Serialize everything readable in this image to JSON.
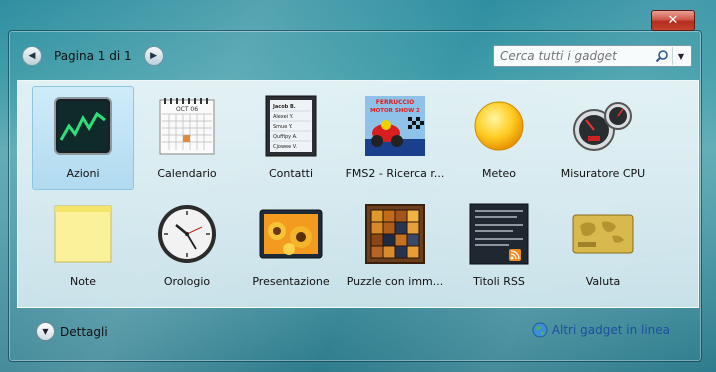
{
  "window": {
    "close_label": "✕"
  },
  "toolbar": {
    "pager_text": "Pagina 1 di 1",
    "prev_glyph": "◀",
    "next_glyph": "▶",
    "search_placeholder": "Cerca tutti i gadget",
    "search_icon": "search-icon",
    "dropdown_glyph": "▼"
  },
  "gadgets": [
    {
      "label": "Azioni",
      "icon": "stocks-icon",
      "selected": true
    },
    {
      "label": "Calendario",
      "icon": "calendar-icon",
      "month": "OCT 06"
    },
    {
      "label": "Contatti",
      "icon": "contacts-icon",
      "names": [
        "Jacob B.",
        "Alexei Y.",
        "Smue Y.",
        "Quffipy A.",
        "Cjowee V."
      ]
    },
    {
      "label": "FMS2 - Ricerca r...",
      "icon": "motor-show-icon",
      "banner": [
        "FERRUCCIO",
        "MOTOR SHOW 2"
      ]
    },
    {
      "label": "Meteo",
      "icon": "weather-sun-icon"
    },
    {
      "label": "Misuratore CPU",
      "icon": "cpu-meter-icon"
    },
    {
      "label": "Note",
      "icon": "sticky-note-icon"
    },
    {
      "label": "Orologio",
      "icon": "clock-icon"
    },
    {
      "label": "Presentazione",
      "icon": "slideshow-icon"
    },
    {
      "label": "Puzzle con imm...",
      "icon": "puzzle-icon"
    },
    {
      "label": "Titoli RSS",
      "icon": "rss-icon"
    },
    {
      "label": "Valuta",
      "icon": "currency-icon"
    }
  ],
  "footer": {
    "details_label": "Dettagli",
    "details_glyph": "▼",
    "more_label": "Altri gadget in linea"
  },
  "colors": {
    "desktop": "#3b9aa7",
    "selection": "#aad7f0",
    "link": "#1b4fa0",
    "close_button": "#c7412f"
  }
}
